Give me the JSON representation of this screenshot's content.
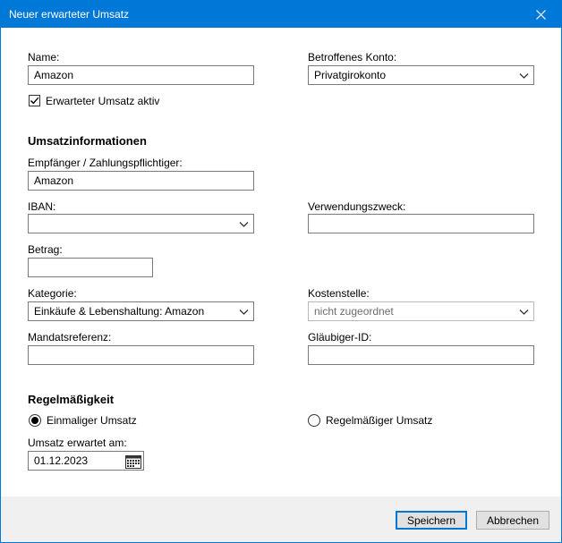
{
  "window": {
    "title": "Neuer erwarteter Umsatz"
  },
  "form": {
    "name_label": "Name:",
    "name_value": "Amazon",
    "account_label": "Betroffenes Konto:",
    "account_value": "Privatgirokonto",
    "active_label": "Erwarteter Umsatz aktiv",
    "active_checked": true
  },
  "section_info": {
    "heading": "Umsatzinformationen",
    "payee_label": "Empfänger / Zahlungspflichtiger:",
    "payee_value": "Amazon",
    "iban_label": "IBAN:",
    "iban_value": "",
    "purpose_label": "Verwendungszweck:",
    "purpose_value": "",
    "amount_label": "Betrag:",
    "amount_value": "",
    "category_label": "Kategorie:",
    "category_value": "Einkäufe & Lebenshaltung: Amazon",
    "costcenter_label": "Kostenstelle:",
    "costcenter_value": "nicht zugeordnet",
    "mandate_label": "Mandatsreferenz:",
    "mandate_value": "",
    "creditor_label": "Gläubiger-ID:",
    "creditor_value": ""
  },
  "section_recurrence": {
    "heading": "Regelmäßigkeit",
    "once_label": "Einmaliger Umsatz",
    "recurring_label": "Regelmäßiger Umsatz",
    "selected": "once",
    "date_label": "Umsatz erwartet am:",
    "date_value": "01.12.2023"
  },
  "buttons": {
    "save": "Speichern",
    "cancel": "Abbrechen"
  },
  "colors": {
    "titlebar": "#0078d7",
    "footer": "#f0f0f0"
  }
}
